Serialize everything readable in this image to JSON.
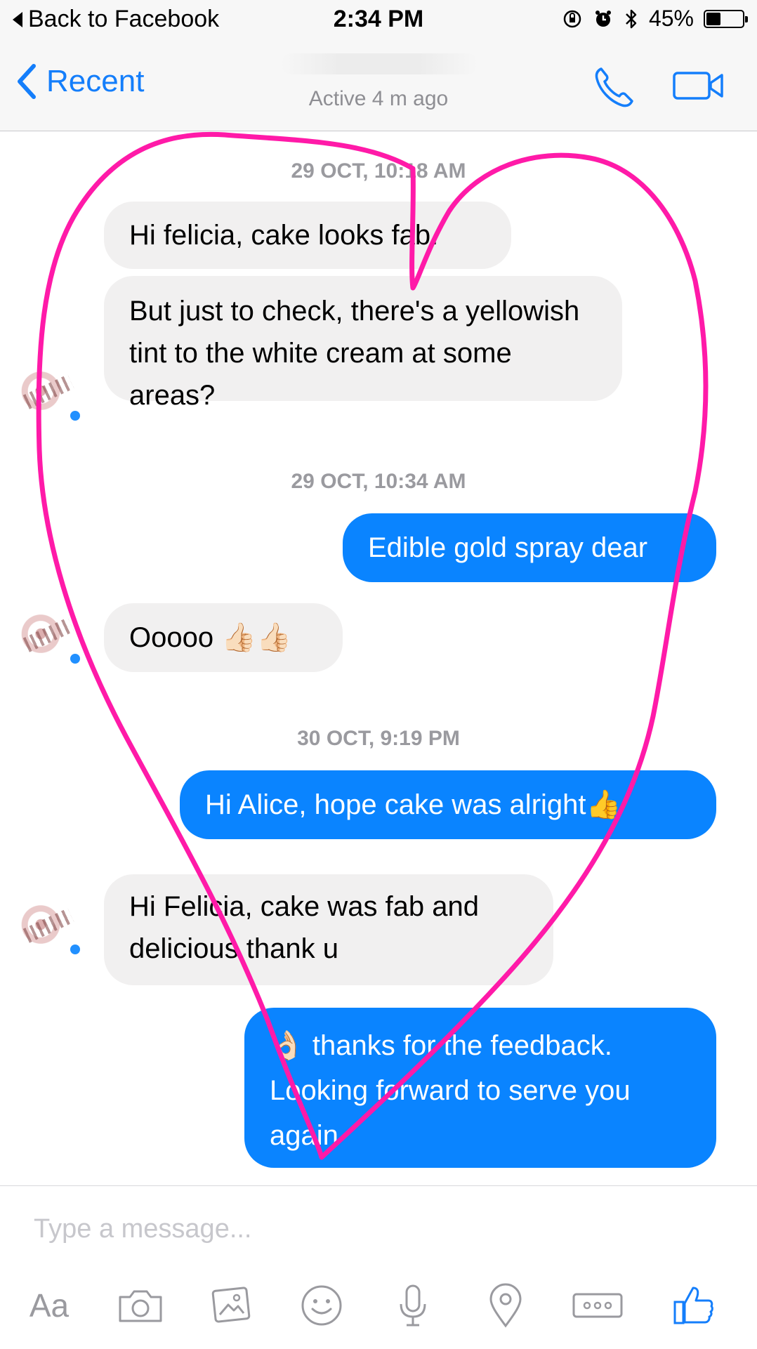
{
  "status_bar": {
    "back_label": "Back to Facebook",
    "time": "2:34 PM",
    "battery": "45%",
    "battery_level": 0.45,
    "icons": [
      "orientation-lock-icon",
      "alarm-icon",
      "bluetooth-icon",
      "battery-icon"
    ]
  },
  "nav": {
    "back_label": "Recent",
    "subtitle": "Active 4 m ago",
    "icons": [
      "call-icon",
      "video-call-icon"
    ],
    "accent": "#147efb"
  },
  "messages": [
    {
      "type": "timestamp",
      "text": "29 OCT, 10:18 AM"
    },
    {
      "type": "incoming",
      "text": "Hi felicia, cake looks fab."
    },
    {
      "type": "incoming",
      "text": "But just to check, there's a yellowish tint to the white cream at some areas?"
    },
    {
      "type": "timestamp",
      "text": "29 OCT, 10:34 AM"
    },
    {
      "type": "outgoing",
      "text": "Edible gold spray dear"
    },
    {
      "type": "incoming",
      "text": "Ooooo 👍🏻👍🏻"
    },
    {
      "type": "timestamp",
      "text": "30 OCT, 9:19 PM"
    },
    {
      "type": "outgoing",
      "text": "Hi Alice, hope cake was alright👍"
    },
    {
      "type": "incoming",
      "text": "Hi Felicia, cake was fab and delicious thank u"
    },
    {
      "type": "outgoing",
      "text": "👌🏻 thanks for the feedback. Looking forward to serve you again"
    }
  ],
  "composer": {
    "placeholder": "Type a message...",
    "aa_label": "Aa",
    "tools": [
      "text-format-icon",
      "camera-icon",
      "gallery-icon",
      "emoji-icon",
      "microphone-icon",
      "location-icon",
      "more-icon",
      "like-icon"
    ]
  },
  "colors": {
    "outgoing_bubble": "#0a84ff",
    "incoming_bubble": "#f1f0f0",
    "annotation_heart": "#ff1aa8"
  }
}
